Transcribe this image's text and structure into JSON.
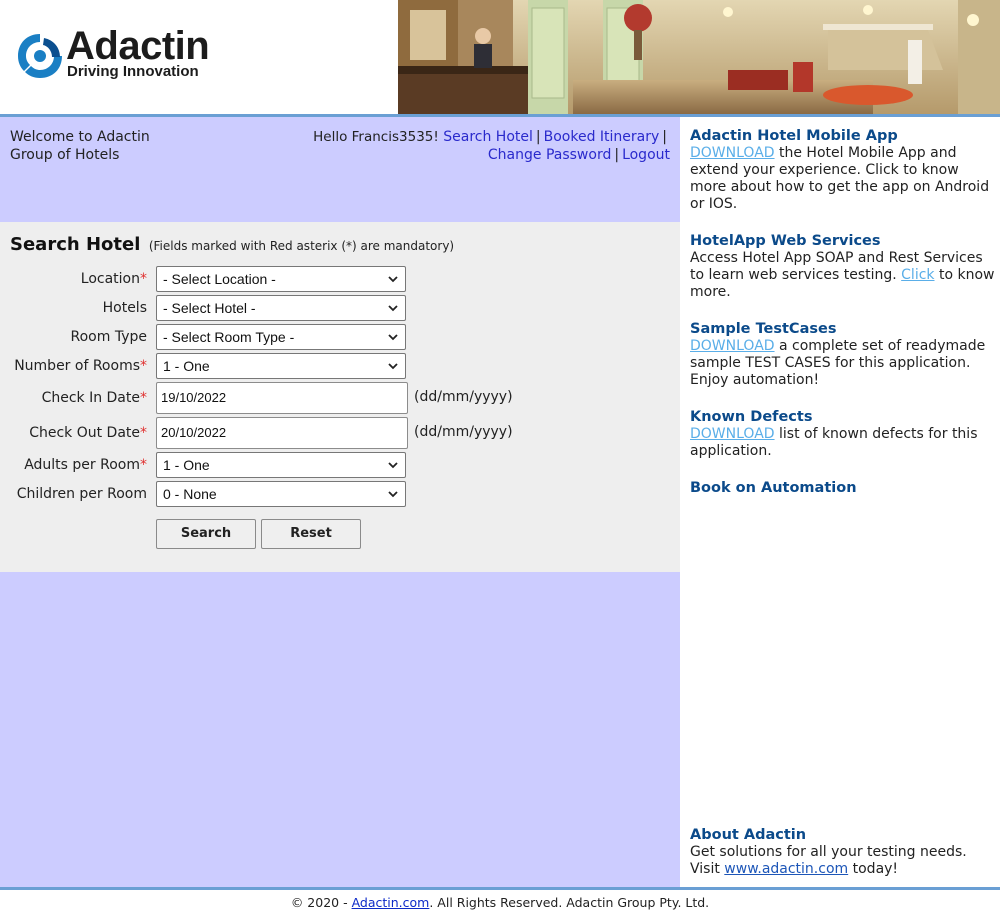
{
  "brand": {
    "name": "Adactin",
    "tagline": "Driving Innovation"
  },
  "welcome": "Welcome to Adactin Group of Hotels",
  "user_nav": {
    "greeting": "Hello Francis3535!",
    "links": [
      "Search Hotel",
      "Booked Itinerary",
      "Change Password",
      "Logout"
    ]
  },
  "search": {
    "title": "Search Hotel",
    "note": "(Fields marked with Red asterix (*) are mandatory)",
    "fields": {
      "location": {
        "label": "Location",
        "value": "- Select Location -"
      },
      "hotels": {
        "label": "Hotels",
        "value": "- Select Hotel -"
      },
      "room_type": {
        "label": "Room Type",
        "value": "- Select Room Type -"
      },
      "rooms": {
        "label": "Number of Rooms",
        "value": "1 - One"
      },
      "checkin": {
        "label": "Check In Date",
        "value": "19/10/2022",
        "hint": "(dd/mm/yyyy)"
      },
      "checkout": {
        "label": "Check Out Date",
        "value": "20/10/2022",
        "hint": "(dd/mm/yyyy)"
      },
      "adults": {
        "label": "Adults per Room",
        "value": "1 - One"
      },
      "children": {
        "label": "Children per Room",
        "value": "0 - None"
      }
    },
    "required_mark": "*",
    "buttons": {
      "search": "Search",
      "reset": "Reset"
    }
  },
  "sidebar": {
    "mobile": {
      "title": "Adactin Hotel Mobile App",
      "link": "DOWNLOAD",
      "text": " the Hotel Mobile App and extend your experience. Click to know more about how to get the app on Android or IOS."
    },
    "webservices": {
      "title": "HotelApp Web Services",
      "text_before": "Access Hotel App SOAP and Rest Services to learn web services testing. ",
      "link": "Click",
      "text_after": " to know more."
    },
    "testcases": {
      "title": "Sample TestCases",
      "link": "DOWNLOAD",
      "text": " a complete set of readymade sample TEST CASES for this application. Enjoy automation!"
    },
    "defects": {
      "title": "Known Defects",
      "link": "DOWNLOAD",
      "text": " list of known defects for this application."
    },
    "book": {
      "title": "Book on Automation"
    },
    "about": {
      "title": "About Adactin",
      "text": "Get solutions for all your testing needs. Visit ",
      "link": "www.adactin.com",
      "text_after": " today!"
    }
  },
  "footer": {
    "prefix": "© 2020 - ",
    "link": "Adactin.com",
    "suffix": ". All Rights Reserved. Adactin Group Pty. Ltd."
  },
  "colors": {
    "header_rule": "#6a9fd4",
    "content_bg": "#ccccff",
    "panel_bg": "#eeeeee",
    "heading": "#0b4a8a",
    "nav_link": "#2a2acc",
    "download_link": "#5aaee8",
    "required": "#e0302f"
  }
}
